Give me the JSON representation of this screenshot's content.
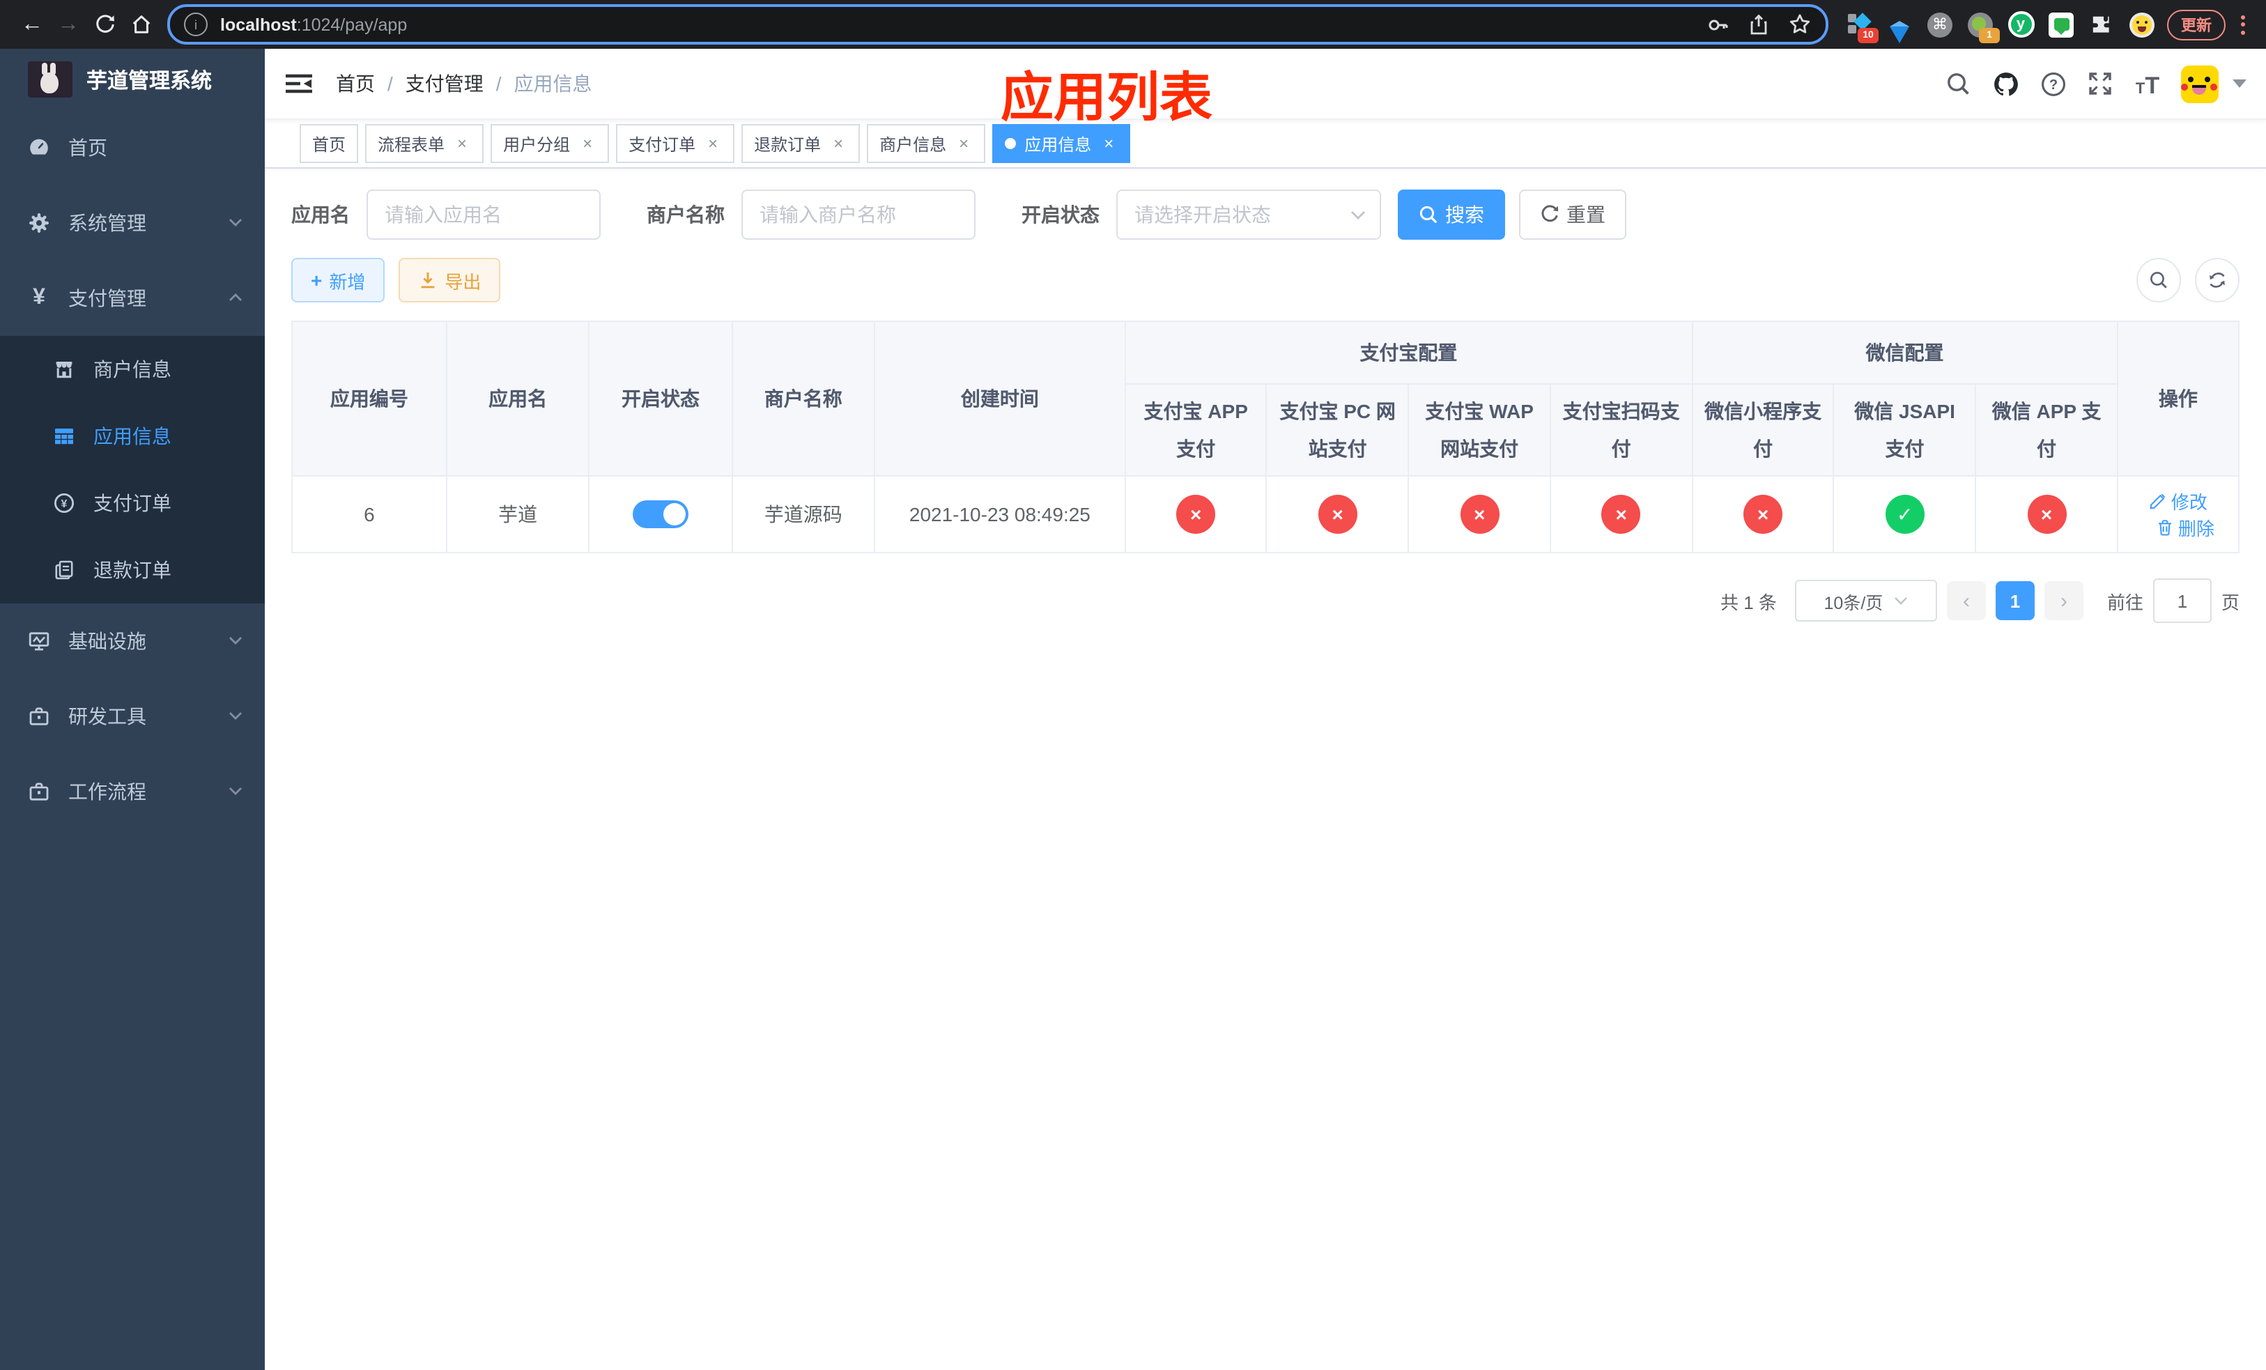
{
  "browser": {
    "url_host": "localhost",
    "url_path": ":1024/pay/app",
    "ext_badge_blue": "10",
    "ext_badge_circle": "1",
    "ext_letter_y": "y",
    "update_label": "更新"
  },
  "icons": {
    "back": "←",
    "forward": "→",
    "cmd": "⌘",
    "close": "×",
    "plus": "+",
    "yen": "¥",
    "letter_t": "T",
    "chevron_left": "‹",
    "chevron_right": "›",
    "question": "?",
    "info": "i"
  },
  "sidebar": {
    "title": "芋道管理系统",
    "items": [
      {
        "label": "首页"
      },
      {
        "label": "系统管理"
      },
      {
        "label": "支付管理",
        "children": [
          {
            "label": "商户信息"
          },
          {
            "label": "应用信息"
          },
          {
            "label": "支付订单"
          },
          {
            "label": "退款订单"
          }
        ]
      },
      {
        "label": "基础设施"
      },
      {
        "label": "研发工具"
      },
      {
        "label": "工作流程"
      }
    ]
  },
  "navbar": {
    "breadcrumb": {
      "items": [
        "首页",
        "支付管理",
        "应用信息"
      ],
      "separator": "/"
    }
  },
  "annotation": {
    "text": "应用列表",
    "color": "#ff2b00"
  },
  "tags": [
    {
      "label": "首页"
    },
    {
      "label": "流程表单"
    },
    {
      "label": "用户分组"
    },
    {
      "label": "支付订单"
    },
    {
      "label": "退款订单"
    },
    {
      "label": "商户信息"
    },
    {
      "label": "应用信息"
    }
  ],
  "filter": {
    "app_name_label": "应用名",
    "app_name_placeholder": "请输入应用名",
    "merchant_label": "商户名称",
    "merchant_placeholder": "请输入商户名称",
    "status_label": "开启状态",
    "status_placeholder": "请选择开启状态",
    "search_label": "搜索",
    "reset_label": "重置"
  },
  "toolbar": {
    "add_label": "新增",
    "export_label": "导出"
  },
  "table": {
    "col_id": "应用编号",
    "col_name": "应用名",
    "col_status": "开启状态",
    "col_merchant": "商户名称",
    "col_created": "创建时间",
    "col_op": "操作",
    "group_alipay": "支付宝配置",
    "group_wechat": "微信配置",
    "alipay_cols": [
      "支付宝 APP 支付",
      "支付宝 PC 网站支付",
      "支付宝 WAP 网站支付",
      "支付宝扫码支付"
    ],
    "wechat_cols": [
      "微信小程序支付",
      "微信 JSAPI 支付",
      "微信 APP 支付"
    ],
    "rows": [
      {
        "id": "6",
        "name": "芋道",
        "status": "on",
        "merchant": "芋道源码",
        "created": "2021-10-23 08:49:25",
        "pay": [
          {
            "state": "off",
            "symbol": "×"
          },
          {
            "state": "off",
            "symbol": "×"
          },
          {
            "state": "off",
            "symbol": "×"
          },
          {
            "state": "off",
            "symbol": "×"
          },
          {
            "state": "off",
            "symbol": "×"
          },
          {
            "state": "on",
            "symbol": "✓"
          },
          {
            "state": "off",
            "symbol": "×"
          }
        ],
        "edit_label": "修改",
        "delete_label": "删除"
      }
    ]
  },
  "pagination": {
    "total": "共 1 条",
    "page_size": "10条/页",
    "page": "1",
    "goto_label": "前往",
    "goto_value": "1",
    "unit_label": "页"
  },
  "colors": {
    "primary": "#409eff",
    "success": "#13ce66",
    "danger": "#f54c4c",
    "annotation": "#ff2b00",
    "sidebar_bg": "#304156",
    "submenu_bg": "#1f2d3d"
  }
}
